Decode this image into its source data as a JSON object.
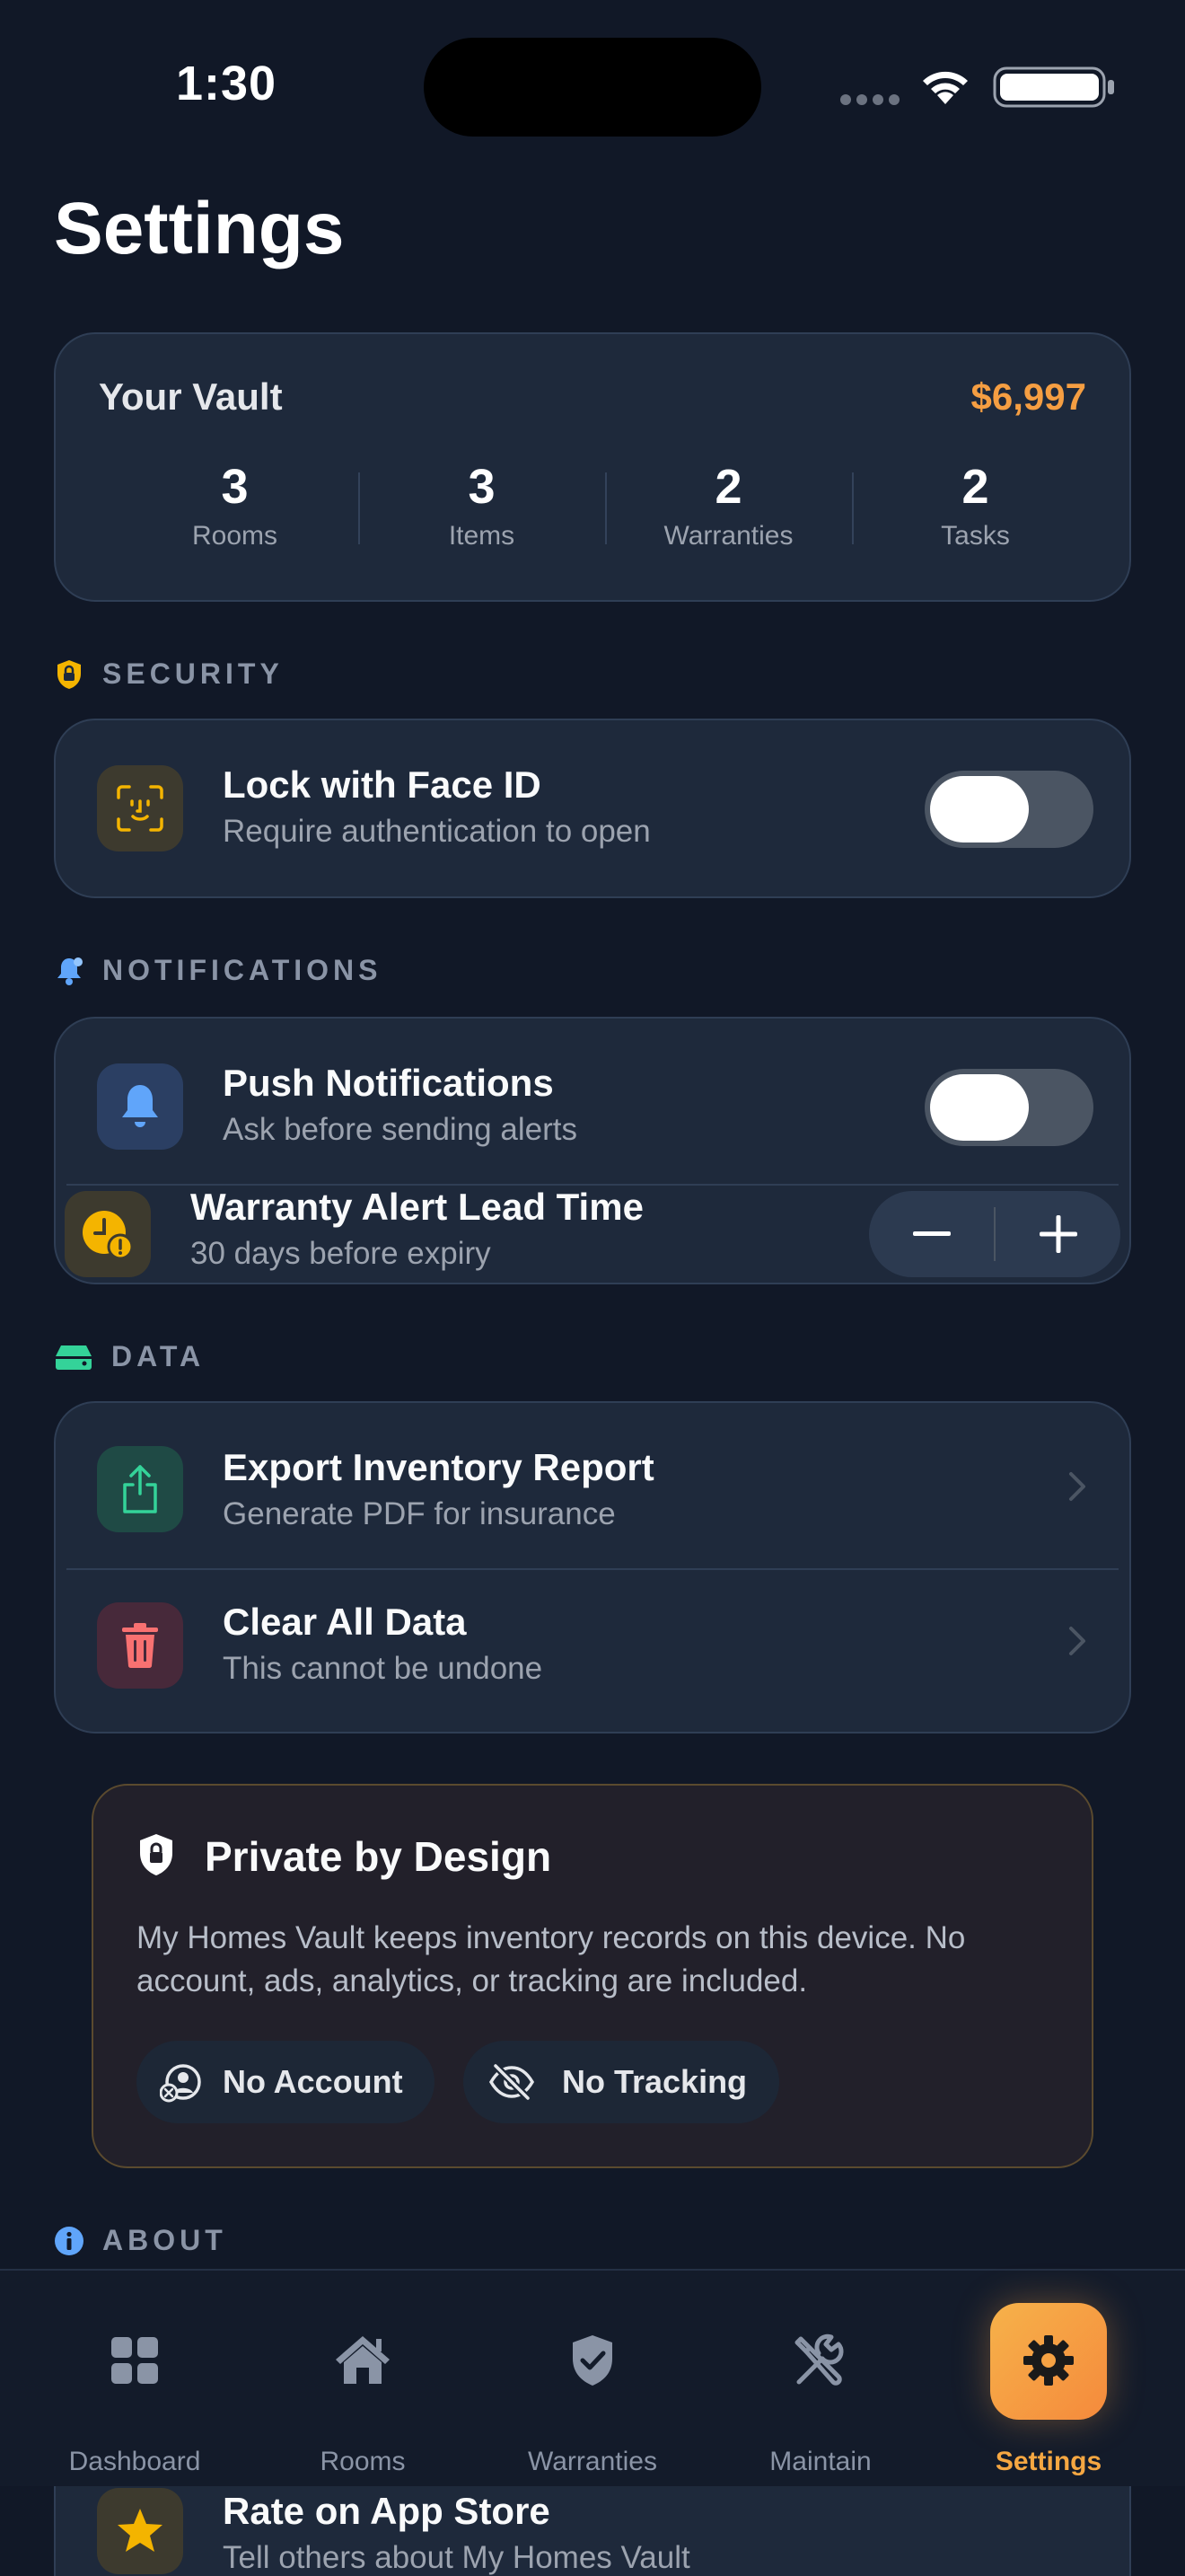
{
  "status_bar": {
    "time": "1:30"
  },
  "page": {
    "title": "Settings"
  },
  "vault": {
    "title": "Your Vault",
    "amount": "$6,997",
    "stats": [
      {
        "value": "3",
        "label": "Rooms"
      },
      {
        "value": "3",
        "label": "Items"
      },
      {
        "value": "2",
        "label": "Warranties"
      },
      {
        "value": "2",
        "label": "Tasks"
      }
    ]
  },
  "security": {
    "header": "SECURITY",
    "face_id": {
      "title": "Lock with Face ID",
      "subtitle": "Require authentication to open",
      "enabled": false
    }
  },
  "notifications": {
    "header": "NOTIFICATIONS",
    "push": {
      "title": "Push Notifications",
      "subtitle": "Ask before sending alerts",
      "enabled": false
    },
    "lead_time": {
      "title": "Warranty Alert Lead Time",
      "subtitle": "30 days before expiry",
      "decrement": "−",
      "increment": "+"
    }
  },
  "data": {
    "header": "DATA",
    "export": {
      "title": "Export Inventory Report",
      "subtitle": "Generate PDF for insurance"
    },
    "clear": {
      "title": "Clear All Data",
      "subtitle": "This cannot be undone"
    }
  },
  "privacy": {
    "title": "Private by Design",
    "body": "My Homes Vault keeps inventory records on this device. No account, ads, analytics, or tracking are included.",
    "pills": [
      "No Account",
      "No Tracking"
    ]
  },
  "about": {
    "header": "ABOUT",
    "rate": {
      "title": "Rate on App Store",
      "subtitle": "Tell others about My Homes Vault"
    }
  },
  "tabbar": {
    "tabs": [
      {
        "label": "Dashboard",
        "icon": "grid-icon"
      },
      {
        "label": "Rooms",
        "icon": "house-icon"
      },
      {
        "label": "Warranties",
        "icon": "shield-check-icon"
      },
      {
        "label": "Maintain",
        "icon": "tools-icon"
      },
      {
        "label": "Settings",
        "icon": "gear-icon"
      }
    ],
    "active": "Settings"
  },
  "colors": {
    "background": "#111827",
    "card": "#1E293B",
    "accent_orange": "#F59E42",
    "security_yellow": "#F4B400",
    "notif_blue": "#60A5FA",
    "data_green": "#34D399",
    "danger_red": "#F87171"
  }
}
